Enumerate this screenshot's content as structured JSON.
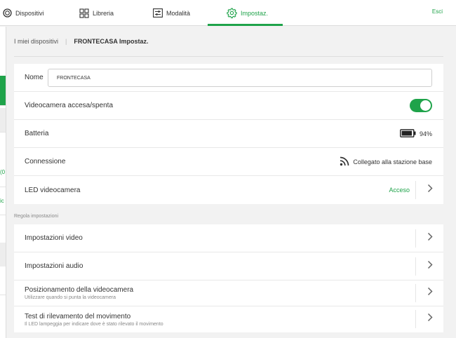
{
  "nav": {
    "devices": "Dispositivi",
    "library": "Libreria",
    "mode": "Modalità",
    "settings": "Impostaz.",
    "logout": "Esci"
  },
  "left_fragments": [
    "0)",
    "ic"
  ],
  "breadcrumb": {
    "parent": "I miei dispositivi",
    "current": "FRONTECASA Impostaz."
  },
  "device_card": {
    "name_label": "Nome",
    "name_value": "FRONTECASA",
    "camera_power_label": "Videocamera accesa/spenta",
    "camera_power_on": true,
    "battery_label": "Batteria",
    "battery_value": "94%",
    "battery_level": 0.94,
    "connection_label": "Connessione",
    "connection_value": "Collegato alla stazione base",
    "led_label": "LED videocamera",
    "led_value": "Acceso"
  },
  "section_title": "Regola impostazioni",
  "settings_card": {
    "video_label": "Impostazioni video",
    "audio_label": "Impostazioni audio",
    "positioning_label": "Posizionamento della videocamera",
    "positioning_sub": "Utilizzare quando si punta la videocamera",
    "motion_label": "Test di rilevamento del movimento",
    "motion_sub": "Il LED lampeggia per indicare dove è stato rilevato il movimento"
  },
  "colors": {
    "accent": "#1fa34a",
    "background": "#f2f2f2"
  },
  "icons": {
    "devices": "circle-device-icon",
    "library": "grid-icon",
    "mode": "sliders-icon",
    "settings": "gear-icon",
    "battery": "battery-icon",
    "connection": "signal-icon",
    "chevron": "chevron-right-icon"
  }
}
